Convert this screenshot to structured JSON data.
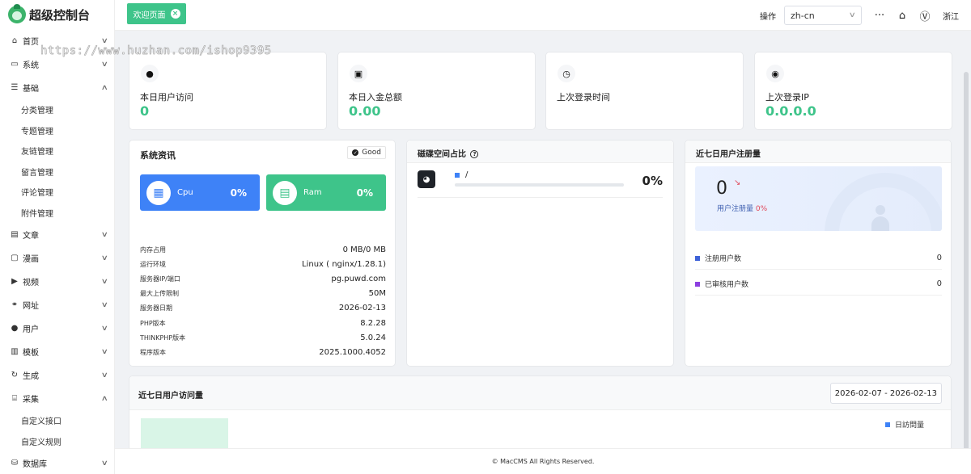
{
  "app": {
    "title": "超级控制台"
  },
  "watermark": "https://www.huzhan.com/ishop9395",
  "sidebar": {
    "items": [
      {
        "label": "首页",
        "icon": "home-icon",
        "glyph": "⌂",
        "expanded": false
      },
      {
        "label": "系统",
        "icon": "monitor-icon",
        "glyph": "▭",
        "expanded": false
      },
      {
        "label": "基础",
        "icon": "list-icon",
        "glyph": "☰",
        "expanded": true,
        "children": [
          "分类管理",
          "专题管理",
          "友链管理",
          "留言管理",
          "评论管理",
          "附件管理"
        ]
      },
      {
        "label": "文章",
        "icon": "article-icon",
        "glyph": "▤",
        "expanded": false
      },
      {
        "label": "漫画",
        "icon": "comic-icon",
        "glyph": "▢",
        "expanded": false
      },
      {
        "label": "视频",
        "icon": "play-icon",
        "glyph": "▶",
        "expanded": false
      },
      {
        "label": "网址",
        "icon": "link-icon",
        "glyph": "⚭",
        "expanded": false
      },
      {
        "label": "用户",
        "icon": "user-icon",
        "glyph": "●",
        "expanded": false
      },
      {
        "label": "模板",
        "icon": "template-icon",
        "glyph": "▥",
        "expanded": false
      },
      {
        "label": "生成",
        "icon": "generate-icon",
        "glyph": "↻",
        "expanded": false
      },
      {
        "label": "采集",
        "icon": "collect-icon",
        "glyph": "⌸",
        "expanded": true,
        "children": [
          "自定义接口",
          "自定义规则"
        ]
      },
      {
        "label": "数据库",
        "icon": "database-icon",
        "glyph": "⛁",
        "expanded": false
      }
    ]
  },
  "topbar": {
    "active_tab": "欢迎页面",
    "close_glyph": "×",
    "operation_label": "操作",
    "language": "zh-cn",
    "more_glyph": "···",
    "home_glyph": "⌂",
    "v_glyph": "Ⓥ",
    "region": "浙江"
  },
  "stats": [
    {
      "label": "本日用户访问",
      "value": "0",
      "icon": "user-icon",
      "glyph": "●"
    },
    {
      "label": "本日入金总额",
      "value": "0.00",
      "icon": "wallet-icon",
      "glyph": "▣"
    },
    {
      "label": "上次登录时间",
      "value": "",
      "icon": "clock-icon",
      "glyph": "◷"
    },
    {
      "label": "上次登录IP",
      "value": "0.0.0.0",
      "icon": "location-icon",
      "glyph": "◉"
    }
  ],
  "system": {
    "title": "系统资讯",
    "badge": "Good",
    "cpu": {
      "name": "Cpu",
      "percent": "0%",
      "glyph": "▦"
    },
    "ram": {
      "name": "Ram",
      "percent": "0%",
      "glyph": "▤"
    },
    "rows": [
      {
        "key": "内存占用",
        "value": "0 MB/0 MB"
      },
      {
        "key": "运行环境",
        "value": "Linux ( nginx/1.28.1)"
      },
      {
        "key": "服务器IP/端口",
        "value": "pg.puwd.com"
      },
      {
        "key": "最大上传限制",
        "value": "50M"
      },
      {
        "key": "服务器日期",
        "value": "2026-02-13"
      },
      {
        "key": "PHP版本",
        "value": "8.2.28"
      },
      {
        "key": "THINKPHP版本",
        "value": "5.0.24"
      },
      {
        "key": "程序版本",
        "value": "2025.1000.4052"
      }
    ]
  },
  "disk": {
    "title": "磁碟空间占比",
    "help_glyph": "?",
    "path": "/",
    "percent": "0%",
    "usage_fraction": 0,
    "glyph": "◕"
  },
  "register": {
    "title": "近七日用户注册量",
    "count": "0",
    "trend_glyph": "↘",
    "sub_label": "用户注册量",
    "sub_percent": "0%",
    "rows": [
      {
        "label": "注册用户数",
        "value": "0",
        "color": "#3e62d8"
      },
      {
        "label": "已审核用户数",
        "value": "0",
        "color": "#8c3fe0"
      }
    ]
  },
  "visits": {
    "title": "近七日用户访问量",
    "date_range": "2026-02-07 - 2026-02-13",
    "legend": "日訪問量"
  },
  "footer": {
    "text": "© MacCMS All Rights Reserved."
  },
  "colors": {
    "accent": "#3ec48a",
    "blue": "#3e82f7"
  }
}
